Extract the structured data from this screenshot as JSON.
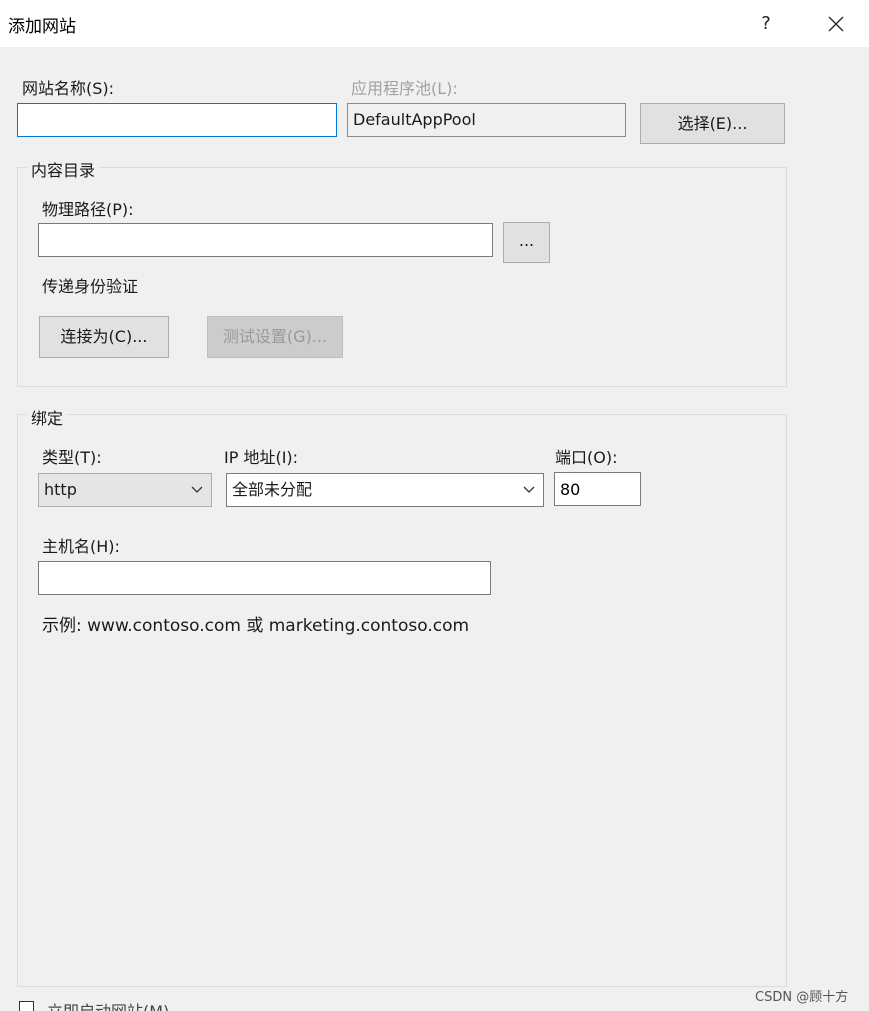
{
  "window": {
    "title": "添加网站",
    "help_label": "?"
  },
  "site_name": {
    "label": "网站名称(S):",
    "value": ""
  },
  "app_pool": {
    "label": "应用程序池(L):",
    "value": "DefaultAppPool",
    "select_button": "选择(E)..."
  },
  "content_dir": {
    "group_title": "内容目录",
    "physical_path_label": "物理路径(P):",
    "physical_path_value": "",
    "browse_button": "...",
    "pass_through_label": "传递身份验证",
    "connect_as_button": "连接为(C)...",
    "test_settings_button": "测试设置(G)..."
  },
  "binding": {
    "group_title": "绑定",
    "type_label": "类型(T):",
    "type_value": "http",
    "ip_label": "IP 地址(I):",
    "ip_value": "全部未分配",
    "port_label": "端口(O):",
    "port_value": "80",
    "host_label": "主机名(H):",
    "host_value": "",
    "example_text": "示例: www.contoso.com 或 marketing.contoso.com"
  },
  "footer": {
    "partial_checkbox_label": "立即启动网站(M)"
  },
  "watermark": "CSDN @顾十方",
  "colors": {
    "focus_border": "#0078d7",
    "dialog_bg": "#f0f0f0",
    "disabled_text": "#a0a0a0"
  }
}
